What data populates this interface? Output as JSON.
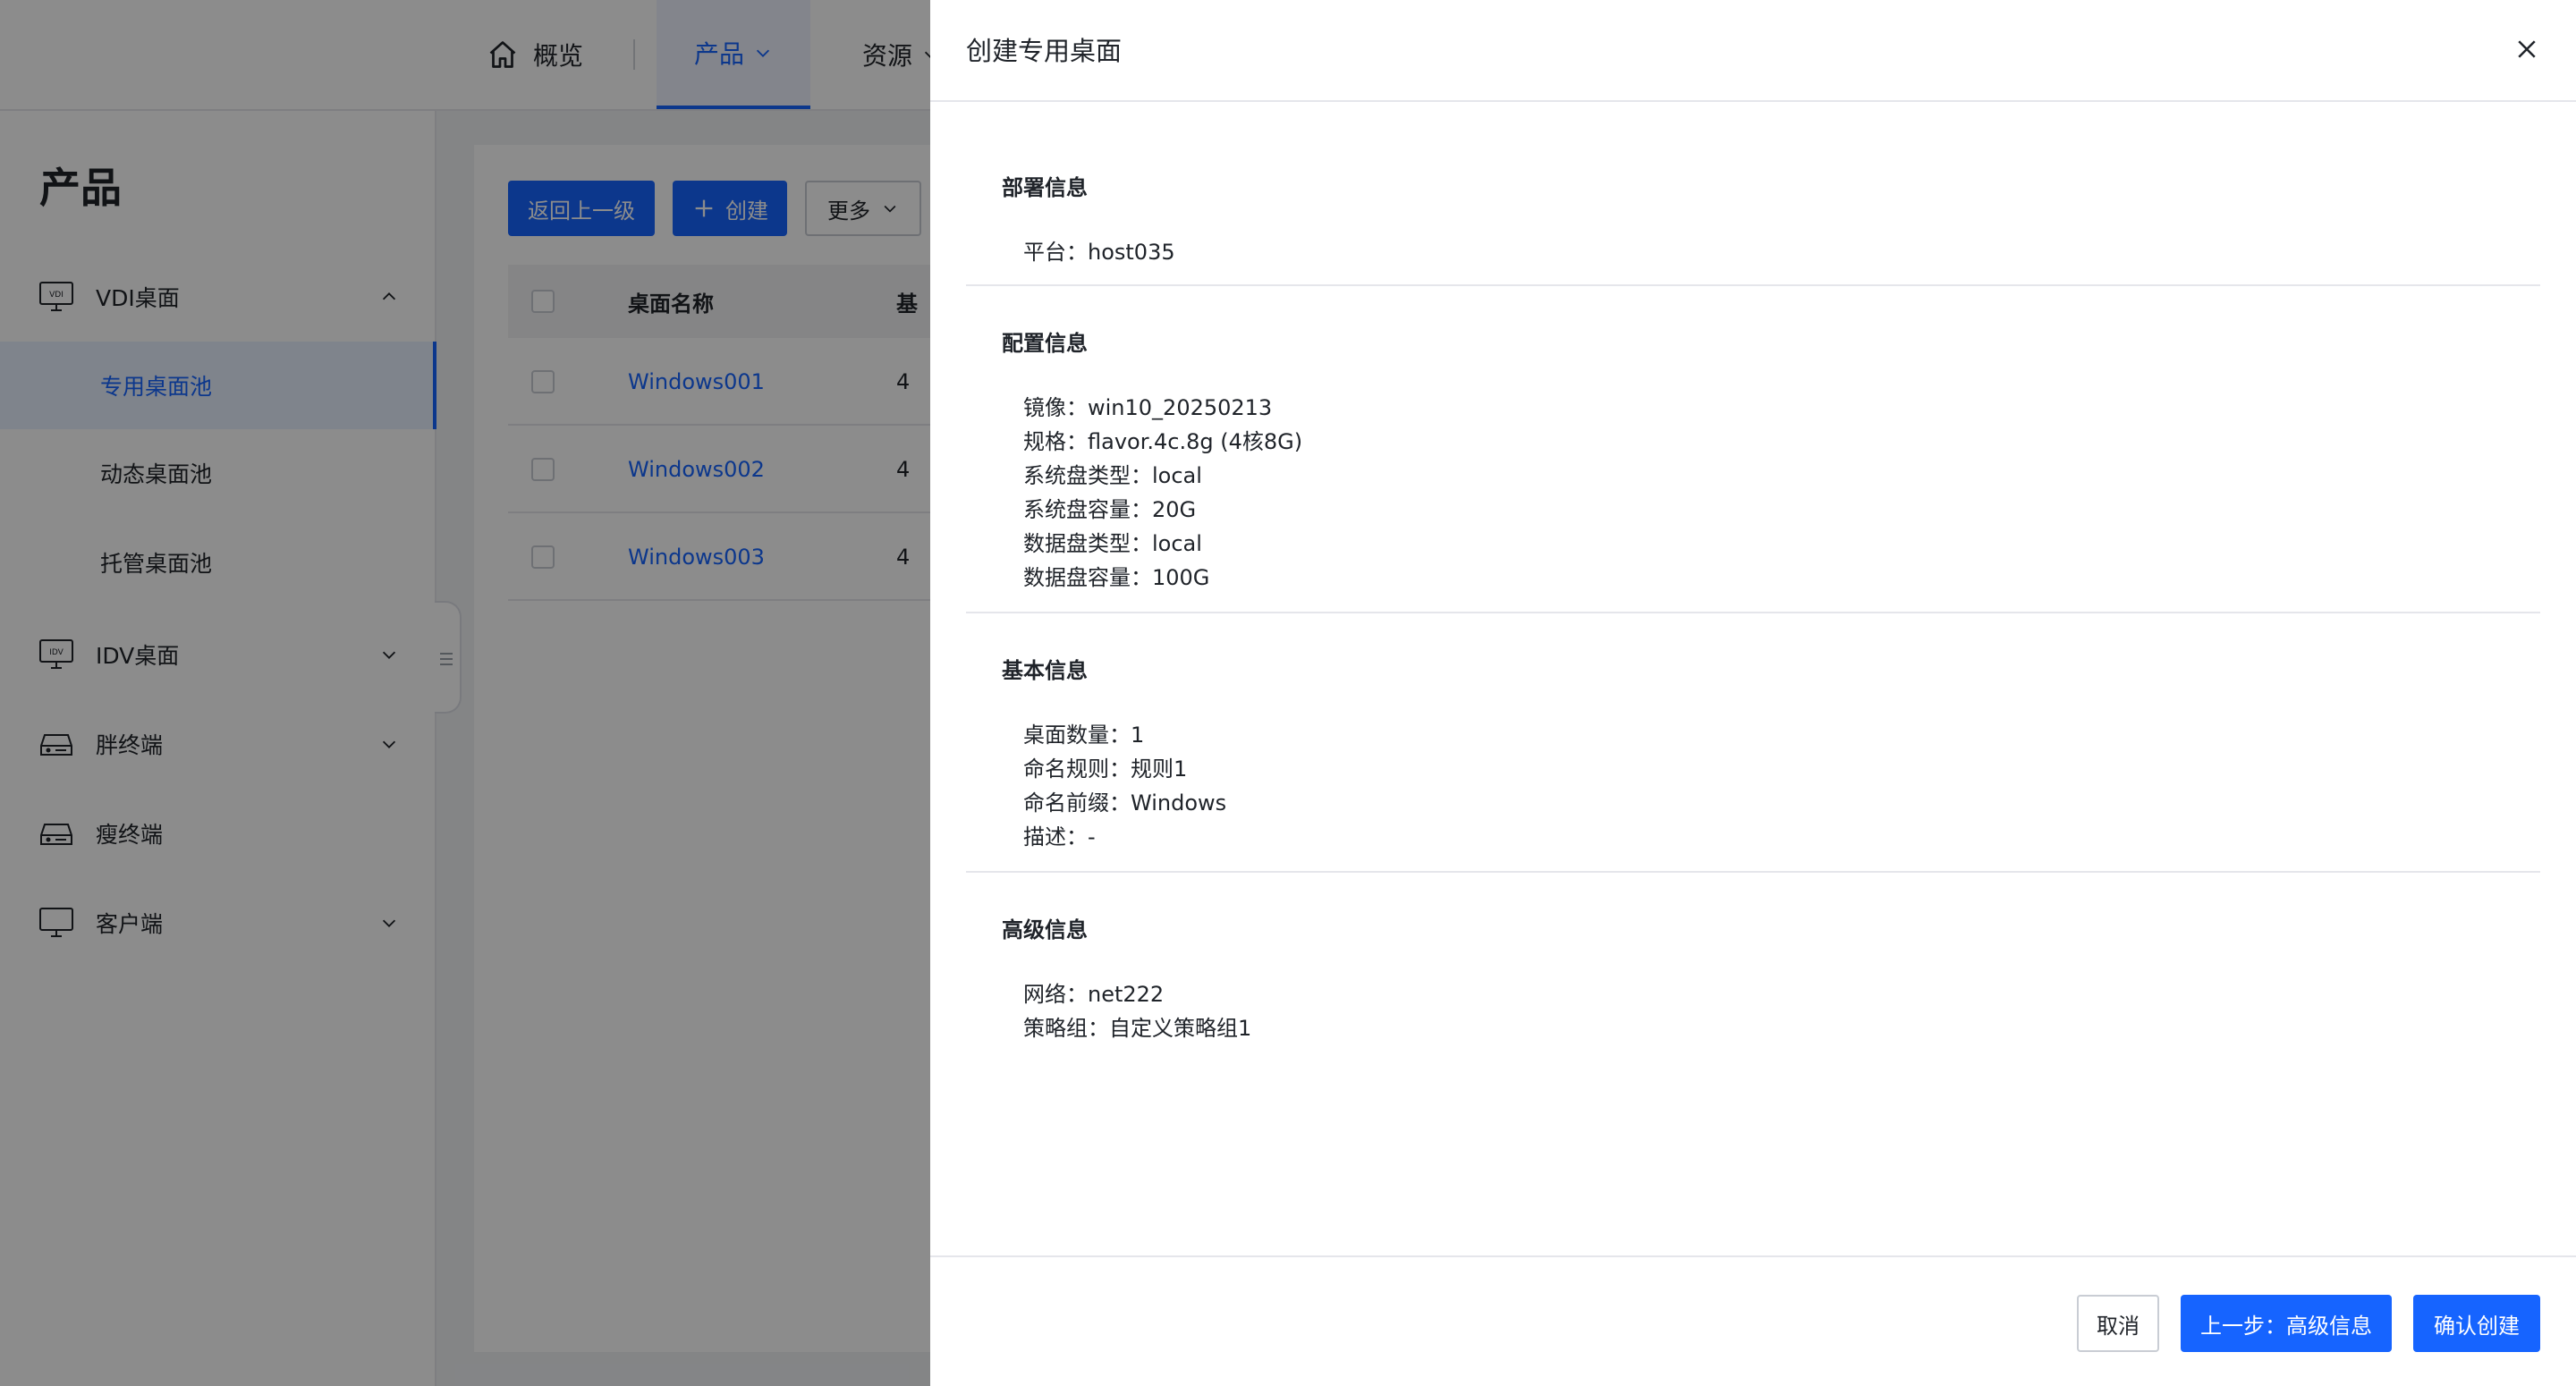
{
  "topnav": {
    "overview": "概览",
    "product": "产品",
    "resource": "资源"
  },
  "sidebar": {
    "title": "产品",
    "groups": [
      {
        "label": "VDI桌面"
      },
      {
        "label": "IDV桌面"
      },
      {
        "label": "胖终端"
      },
      {
        "label": "瘦终端"
      },
      {
        "label": "客户端"
      }
    ],
    "vdi_items": [
      {
        "label": "专用桌面池"
      },
      {
        "label": "动态桌面池"
      },
      {
        "label": "托管桌面池"
      }
    ]
  },
  "toolbar": {
    "back": "返回上一级",
    "create": "创建",
    "more": "更多"
  },
  "table": {
    "col_name": "桌面名称",
    "col2": "基",
    "rows": [
      {
        "name": "Windows001",
        "c2": "4"
      },
      {
        "name": "Windows002",
        "c2": "4"
      },
      {
        "name": "Windows003",
        "c2": "4"
      }
    ]
  },
  "drawer": {
    "title": "创建专用桌面",
    "sections": {
      "deploy": {
        "title": "部署信息",
        "items": [
          {
            "text": "平台：host035"
          }
        ]
      },
      "config": {
        "title": "配置信息",
        "items": [
          {
            "text": "镜像：win10_20250213"
          },
          {
            "text": "规格：flavor.4c.8g (4核8G)"
          },
          {
            "text": "系统盘类型：local"
          },
          {
            "text": "系统盘容量：20G"
          },
          {
            "text": "数据盘类型：local"
          },
          {
            "text": "数据盘容量：100G"
          }
        ]
      },
      "basic": {
        "title": "基本信息",
        "items": [
          {
            "text": "桌面数量：1"
          },
          {
            "text": "命名规则：规则1"
          },
          {
            "text": "命名前缀：Windows"
          },
          {
            "text": "描述：-"
          }
        ]
      },
      "advanced": {
        "title": "高级信息",
        "items": [
          {
            "text": "网络：net222"
          },
          {
            "text": "策略组：自定义策略组1"
          }
        ]
      }
    },
    "footer": {
      "cancel": "取消",
      "prev": "上一步：高级信息",
      "confirm": "确认创建"
    }
  },
  "colors": {
    "primary": "#1664ff",
    "text": "#1f2329",
    "border": "#e5e6eb",
    "mask": "rgba(0,0,0,0.45)"
  }
}
